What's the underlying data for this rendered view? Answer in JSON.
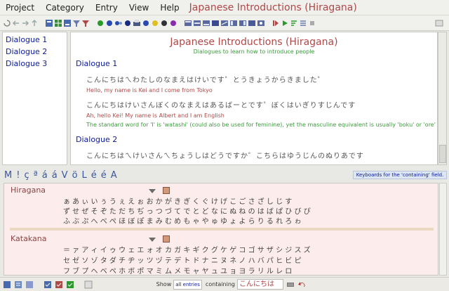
{
  "menubar": {
    "items": [
      "Project",
      "Category",
      "Entry",
      "View",
      "Help"
    ],
    "window_title": "Japanese Introductions (Hiragana)"
  },
  "sidebar": {
    "items": [
      "Dialogue 1",
      "Dialogue 2",
      "Dialogue 3"
    ]
  },
  "content": {
    "title": "Japanese Introductions (Hiragana)",
    "subtitle": "Dialogues to learn how to introduce people",
    "dialogue1_heading": "Dialogue 1",
    "lines": [
      {
        "jp": "こんにちはㄟわたしのなまえはけいです゜とうきょうからきました゜",
        "en": "Hello, my name is Kei and I come from Tokyo"
      },
      {
        "jp": "こんにちはけいさんぼくのなまえはあるばーとです゜ぼくはいぎりすじんです",
        "en": "Ah, hello Kei! My name is Albert and I am English",
        "note": "The standard word for 'I' is 'watashi' (could also be used for feminine), yet the masculine equivalent is usually 'boku' or 'ore'"
      }
    ],
    "dialogue2_heading": "Dialogue 2",
    "dialogue2_line": "こんにちはㄟけいさんㄟちょうしはどうですか゜こちらはゆうじんのぬりあです"
  },
  "keyboard_bar": {
    "chars": [
      "M",
      "!",
      "ç",
      "ª",
      "á",
      "á",
      "V",
      "ö",
      "L",
      "é",
      "é",
      "A"
    ],
    "tip": "Keyboards for the 'containing' field."
  },
  "panel": {
    "hiragana_label": "Hiragana",
    "hiragana_rows": [
      "ぁ あ ぃ い ぅ う ぇ え ぉ お か が き ぎ く ぐ け げ こ ご さ ざ し じ す",
      "ず せ ぜ そ ぞ た だ ち ぢ っ つ づ て で と ど な に ぬ ね の は ば ぱ ひ び ぴ",
      "ふ ぶ ぷ へ べ ぺ ほ ぼ ぽ ま み む め も ゃ や ゅ ゆ ょ よ ら り る れ ろ ゎ"
    ],
    "katakana_label": "Katakana",
    "katakana_rows": [
      "＝ ァ ア ィ イ ゥ ウ ェ エ ォ オ カ ガ キ ギ ク グ ケ ゲ コ ゴ サ ザ シ ジ ス ズ",
      "セ ゼ ソ ゾ タ ダ チ ヂ ッ ツ ヅ テ デ ト ド ナ ニ ヌ ネ ノ ハ バ パ ヒ ビ ピ",
      "フ ブ プ ヘ ベ ペ ホ ボ ポ マ ミ ム メ モ ャ ヤ ュ ユ ョ ヨ ラ リ ル レ ロ"
    ]
  },
  "statusbar": {
    "show_label": "Show",
    "show_value": "all entries",
    "containing_label": "containing",
    "search_value": "こんにちは"
  },
  "colors": {
    "title_red": "#b04848",
    "link_blue": "#0a1a9c",
    "note_green": "#3c9a3c",
    "panel_pink": "#fdecec"
  }
}
